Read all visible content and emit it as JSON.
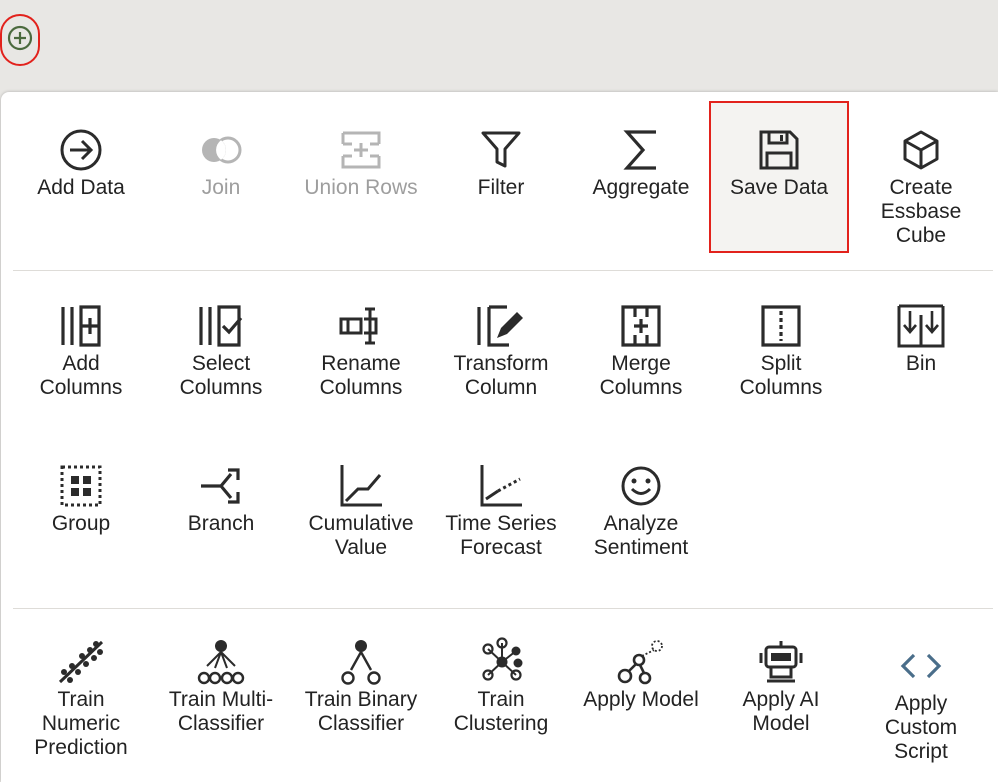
{
  "topbar": {
    "add_button_icon": "plus-circle-icon"
  },
  "menu": {
    "row1": [
      {
        "label": "Add Data",
        "icon": "arrow-right-circle-icon"
      },
      {
        "label": "Join",
        "icon": "join-icon",
        "disabled": true
      },
      {
        "label": "Union Rows",
        "icon": "union-rows-icon",
        "disabled": true
      },
      {
        "label": "Filter",
        "icon": "filter-icon"
      },
      {
        "label": "Aggregate",
        "icon": "sigma-icon"
      },
      {
        "label": "Save Data",
        "icon": "floppy-disk-icon",
        "selected": true
      },
      {
        "label": "Create\nEssbase\nCube",
        "icon": "cube-icon"
      }
    ],
    "row2": [
      {
        "label": "Add\nColumns",
        "icon": "add-columns-icon"
      },
      {
        "label": "Select\nColumns",
        "icon": "select-columns-icon"
      },
      {
        "label": "Rename\nColumns",
        "icon": "rename-columns-icon"
      },
      {
        "label": "Transform\nColumn",
        "icon": "transform-column-icon"
      },
      {
        "label": "Merge\nColumns",
        "icon": "merge-columns-icon"
      },
      {
        "label": "Split\nColumns",
        "icon": "split-columns-icon"
      },
      {
        "label": "Bin",
        "icon": "bin-icon"
      }
    ],
    "row3": [
      {
        "label": "Group",
        "icon": "group-icon"
      },
      {
        "label": "Branch",
        "icon": "branch-icon"
      },
      {
        "label": "Cumulative\nValue",
        "icon": "cumulative-value-icon"
      },
      {
        "label": "Time Series\nForecast",
        "icon": "time-series-icon"
      },
      {
        "label": "Analyze\nSentiment",
        "icon": "smiley-icon"
      }
    ],
    "row4": [
      {
        "label": "Train\nNumeric\nPrediction",
        "icon": "numeric-prediction-icon"
      },
      {
        "label": "Train Multi-\nClassifier",
        "icon": "multi-classifier-icon"
      },
      {
        "label": "Train Binary\nClassifier",
        "icon": "binary-classifier-icon"
      },
      {
        "label": "Train\nClustering",
        "icon": "clustering-icon"
      },
      {
        "label": "Apply Model",
        "icon": "apply-model-icon"
      },
      {
        "label": "Apply AI\nModel",
        "icon": "robot-icon"
      },
      {
        "label": "Apply\nCustom\nScript",
        "icon": "code-brackets-icon"
      }
    ]
  },
  "colors": {
    "icon": "#2b2b2b",
    "disabled": "#9e9e9e",
    "highlight": "#e2221c",
    "add_icon": "#4b6a3e",
    "code_icon": "#4a6e8a"
  }
}
